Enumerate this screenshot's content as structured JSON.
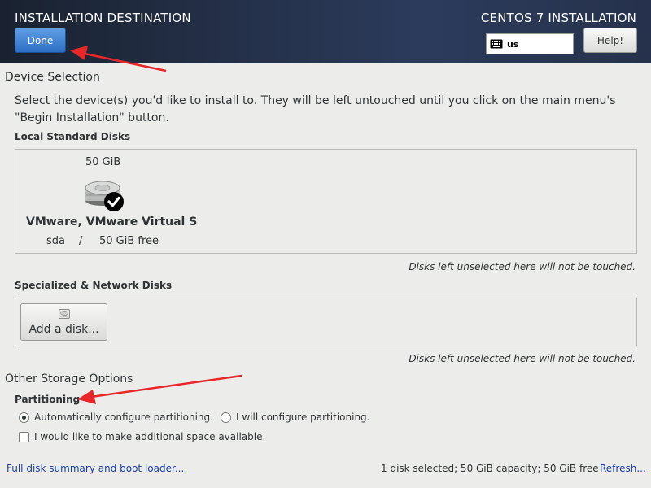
{
  "header": {
    "title": "INSTALLATION DESTINATION",
    "product": "CENTOS 7 INSTALLATION",
    "done_label": "Done",
    "help_label": "Help!",
    "keyboard_layout": "us"
  },
  "device_selection": {
    "title": "Device Selection",
    "intro_line1": "Select the device(s) you'd like to install to.  They will be left untouched until you click on the main menu's",
    "intro_line2": "\"Begin Installation\" button.",
    "local_label": "Local Standard Disks",
    "disks": [
      {
        "size": "50 GiB",
        "name": "VMware, VMware Virtual S",
        "device": "sda",
        "separator": "/",
        "free": "50 GiB free",
        "selected": true
      }
    ],
    "unselected_note": "Disks left unselected here will not be touched.",
    "specialized_label": "Specialized & Network Disks",
    "add_disk_label": "Add a disk...",
    "specialized_note": "Disks left unselected here will not be touched."
  },
  "other_storage": {
    "title": "Other Storage Options",
    "partitioning_label": "Partitioning",
    "auto_option": "Automatically configure partitioning.",
    "manual_option": "I will configure partitioning.",
    "auto_selected": true,
    "extra_space_option": "I would like to make additional space available.",
    "extra_space_checked": false
  },
  "footer": {
    "summary_link": "Full disk summary and boot loader...",
    "status": "1 disk selected; 50 GiB capacity; 50 GiB free",
    "refresh_link": "Refresh..."
  },
  "annotations": {
    "arrow_color": "#e8272a"
  },
  "colors": {
    "header_bg": "#243048",
    "done_button": "#3a7bd5",
    "link": "#1b3fa0"
  }
}
